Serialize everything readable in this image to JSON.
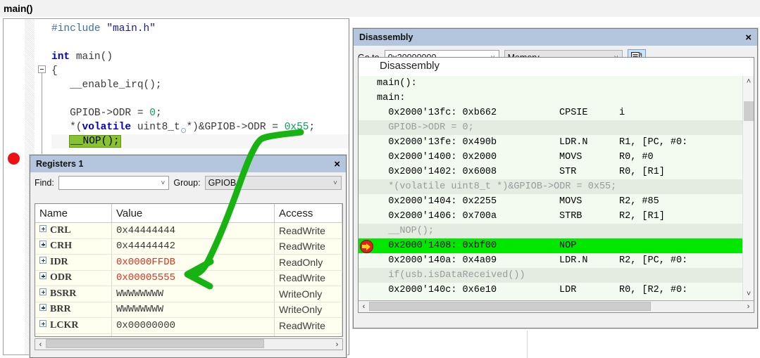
{
  "window": {
    "function_title": "main()"
  },
  "editor": {
    "breakpoint_line": 8,
    "lines": [
      {
        "id": "l1",
        "segments": [
          {
            "t": "#include ",
            "c": "pp"
          },
          {
            "t": "\"main.h\"",
            "c": "str"
          }
        ]
      },
      {
        "id": "l2",
        "segments": []
      },
      {
        "id": "l3",
        "segments": [
          {
            "t": "int ",
            "c": "kw"
          },
          {
            "t": "main()",
            "c": "plain"
          }
        ]
      },
      {
        "id": "l4",
        "segments": [
          {
            "t": "{",
            "c": "plain"
          }
        ]
      },
      {
        "id": "l5",
        "segments": [
          {
            "t": "   __enable_irq();",
            "c": "plain"
          }
        ]
      },
      {
        "id": "l6",
        "segments": []
      },
      {
        "id": "l7",
        "segments": [
          {
            "t": "   GPIOB->ODR = ",
            "c": "plain"
          },
          {
            "t": "0",
            "c": "num"
          },
          {
            "t": ";",
            "c": "plain"
          }
        ]
      },
      {
        "id": "l8",
        "segments": [
          {
            "t": "   *(",
            "c": "plain"
          },
          {
            "t": "volatile",
            "c": "kw"
          },
          {
            "t": " uint8_t *)&GPIOB->ODR = ",
            "c": "plain"
          },
          {
            "t": "0x55",
            "c": "num"
          },
          {
            "t": ";",
            "c": "plain"
          }
        ]
      },
      {
        "id": "l9",
        "segments": [
          {
            "t": "   ",
            "c": "plain"
          },
          {
            "t": "__NOP();",
            "c": "nop"
          }
        ]
      }
    ]
  },
  "registers_panel": {
    "title": "Registers 1",
    "close_label": "×",
    "find_label": "Find:",
    "find_value": "",
    "group_label": "Group:",
    "group_value": "GPIOB",
    "columns": [
      "Name",
      "Value",
      "Access"
    ],
    "rows": [
      {
        "name": "CRL",
        "value": "0x44444444",
        "access": "ReadWrite",
        "changed": false
      },
      {
        "name": "CRH",
        "value": "0x44444442",
        "access": "ReadWrite",
        "changed": false
      },
      {
        "name": "IDR",
        "value": "0x0000FFDB",
        "access": "ReadOnly",
        "changed": true
      },
      {
        "name": "ODR",
        "value": "0x00005555",
        "access": "ReadWrite",
        "changed": true
      },
      {
        "name": "BSRR",
        "value": "WWWWWWWW",
        "access": "WriteOnly",
        "changed": false
      },
      {
        "name": "BRR",
        "value": "WWWWWWWW",
        "access": "WriteOnly",
        "changed": false
      },
      {
        "name": "LCKR",
        "value": "0x00000000",
        "access": "ReadWrite",
        "changed": false
      },
      {
        "name": "",
        "value": "",
        "access": "",
        "changed": false
      }
    ],
    "scroll_left_arrow": "‹",
    "scroll_right_arrow": "›"
  },
  "disassembly_panel": {
    "title": "Disassembly",
    "close_label": "×",
    "goto_label": "Go to",
    "goto_value": "0x20000000",
    "mode_value": "Memory",
    "source_button_icon": "source-document-icon",
    "header": "Disassembly",
    "scroll_up_arrow": "˄",
    "scroll_down_arrow": "˅",
    "scroll_left_arrow": "‹",
    "scroll_right_arrow": "›",
    "lines": [
      {
        "kind": "label",
        "addr": "main():",
        "mnem": "",
        "ops": "",
        "current": false
      },
      {
        "kind": "label",
        "addr": "main:",
        "mnem": "",
        "ops": "",
        "current": false
      },
      {
        "kind": "code",
        "addr": "  0x2000'13fc: 0xb662",
        "mnem": "CPSIE",
        "ops": "i",
        "current": false
      },
      {
        "kind": "source",
        "addr": "  GPIOB->ODR = 0;",
        "mnem": "",
        "ops": "",
        "current": false
      },
      {
        "kind": "code",
        "addr": "  0x2000'13fe: 0x490b",
        "mnem": "LDR.N",
        "ops": "R1, [PC, #0:",
        "current": false
      },
      {
        "kind": "code",
        "addr": "  0x2000'1400: 0x2000",
        "mnem": "MOVS",
        "ops": "R0, #0",
        "current": false
      },
      {
        "kind": "code",
        "addr": "  0x2000'1402: 0x6008",
        "mnem": "STR",
        "ops": "R0, [R1]",
        "current": false
      },
      {
        "kind": "source",
        "addr": "  *(volatile uint8_t *)&GPIOB->ODR = 0x55;",
        "mnem": "",
        "ops": "",
        "current": false
      },
      {
        "kind": "code",
        "addr": "  0x2000'1404: 0x2255",
        "mnem": "MOVS",
        "ops": "R2, #85",
        "current": false
      },
      {
        "kind": "code",
        "addr": "  0x2000'1406: 0x700a",
        "mnem": "STRB",
        "ops": "R2, [R1]",
        "current": false
      },
      {
        "kind": "source",
        "addr": "  __NOP();",
        "mnem": "",
        "ops": "",
        "current": false
      },
      {
        "kind": "code",
        "addr": "  0x2000'1408: 0xbf00",
        "mnem": "NOP",
        "ops": "",
        "current": true
      },
      {
        "kind": "code",
        "addr": "  0x2000'140a: 0x4a09",
        "mnem": "LDR.N",
        "ops": "R2, [PC, #0:",
        "current": false
      },
      {
        "kind": "source",
        "addr": "  if(usb.isDataReceived())",
        "mnem": "",
        "ops": "",
        "current": false
      },
      {
        "kind": "code",
        "addr": "  0x2000'140c: 0x6e10",
        "mnem": "LDR",
        "ops": "R0, [R2, #0:",
        "current": false
      }
    ]
  },
  "annotation": {
    "color": "#16b312",
    "description": "green-arrow-pointing-to-odr-value"
  }
}
